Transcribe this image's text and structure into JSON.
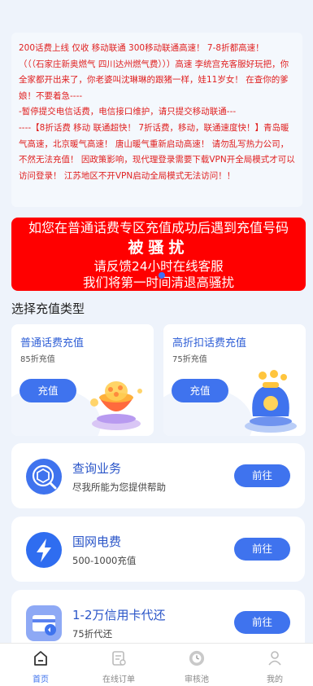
{
  "notice": {
    "lines": [
      "200话费上线 仅收 移动联通 300移动联通高速！ 7-8折都高速！",
      "（（（石家庄新奥燃气 四川达州燃气费）））高速 李统宫充客服好玩把，你全家都开出来了，你老婆叫沈琳琳的跟猪一样，娃11岁女！ 在查你的爹娘！不要着急----",
      "-暂停提交电信话费，电信接口维护，请只提交移动联通---",
      "----【8折话费 移动 联通超快！ 7折话费，移动，联通速度快！】青岛暖气高速，北京暖气高速！ 唐山暖气重新启动高速！ 请勿乱写热力公司，不然无法充值！ 因政策影响，现代理登录需要下载VPN开全局模式才可以访问登录！ 江苏地区不开VPN启动全局模式无法访问！！"
    ]
  },
  "banner": {
    "line1": "如您在普通话费专区充值成功后遇到充值号码",
    "line2": "被骚扰",
    "line3": "请反馈24小时在线客服",
    "line4": "我们将第一时间清退高骚扰"
  },
  "section_title": "选择充值类型",
  "recharge_cards": [
    {
      "name": "普通话费充值",
      "sub": "85折充值",
      "button": "充值"
    },
    {
      "name": "高折扣话费充值",
      "sub": "75折充值",
      "button": "充值"
    }
  ],
  "services": [
    {
      "title": "查询业务",
      "desc": "尽我所能为您提供帮助",
      "button": "前往"
    },
    {
      "title": "国网电费",
      "desc": "500-1000充值",
      "button": "前往"
    },
    {
      "title": "1-2万信用卡代还",
      "desc": "75折代还",
      "button": "前往"
    }
  ],
  "tabbar": [
    {
      "label": "首页",
      "icon": "home-icon"
    },
    {
      "label": "在线订单",
      "icon": "order-icon"
    },
    {
      "label": "审核池",
      "icon": "review-icon"
    },
    {
      "label": "我的",
      "icon": "user-icon"
    }
  ],
  "colors": {
    "accent": "#3f73ee",
    "banner": "#ff0000",
    "notice_text": "#e02020"
  }
}
